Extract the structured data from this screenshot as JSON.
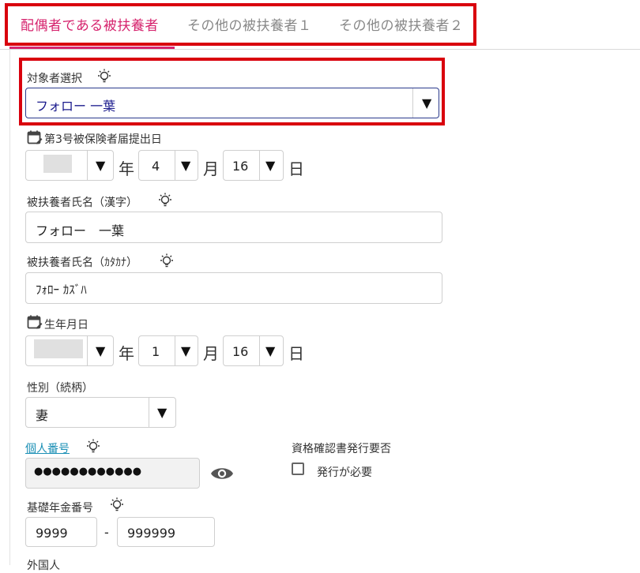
{
  "tabs": [
    {
      "label": "配偶者である被扶養者",
      "active": true
    },
    {
      "label": "その他の被扶養者１",
      "active": false
    },
    {
      "label": "その他の被扶養者２",
      "active": false
    }
  ],
  "target": {
    "label": "対象者選択",
    "value": "フォロー 一葉"
  },
  "submission_date": {
    "label": "第3号被保険者届提出日",
    "year": "",
    "month": "4",
    "day": "16",
    "year_unit": "年",
    "month_unit": "月",
    "day_unit": "日"
  },
  "name_kanji": {
    "label": "被扶養者氏名（漢字）",
    "value": "フォロー　一葉"
  },
  "name_kana": {
    "label": "被扶養者氏名（ｶﾀｶﾅ）",
    "value": "ﾌｫﾛｰ ｶｽﾞﾊ"
  },
  "birthdate": {
    "label": "生年月日",
    "year": "",
    "month": "1",
    "day": "16",
    "year_unit": "年",
    "month_unit": "月",
    "day_unit": "日"
  },
  "relation": {
    "label": "性別（続柄）",
    "value": "妻"
  },
  "my_number": {
    "label": "個人番号",
    "value": "●●●●●●●●●●●●"
  },
  "certificate": {
    "label": "資格確認書発行要否",
    "checkbox_label": "発行が必要",
    "checked": false
  },
  "pension": {
    "label": "基礎年金番号",
    "part1": "9999",
    "dash": "-",
    "part2": "999999"
  },
  "next_label": "外国人",
  "dropdown_arrow": "▼",
  "colors": {
    "accent": "#d6246e",
    "highlight": "#d9000d",
    "link": "#1a8fb5"
  }
}
